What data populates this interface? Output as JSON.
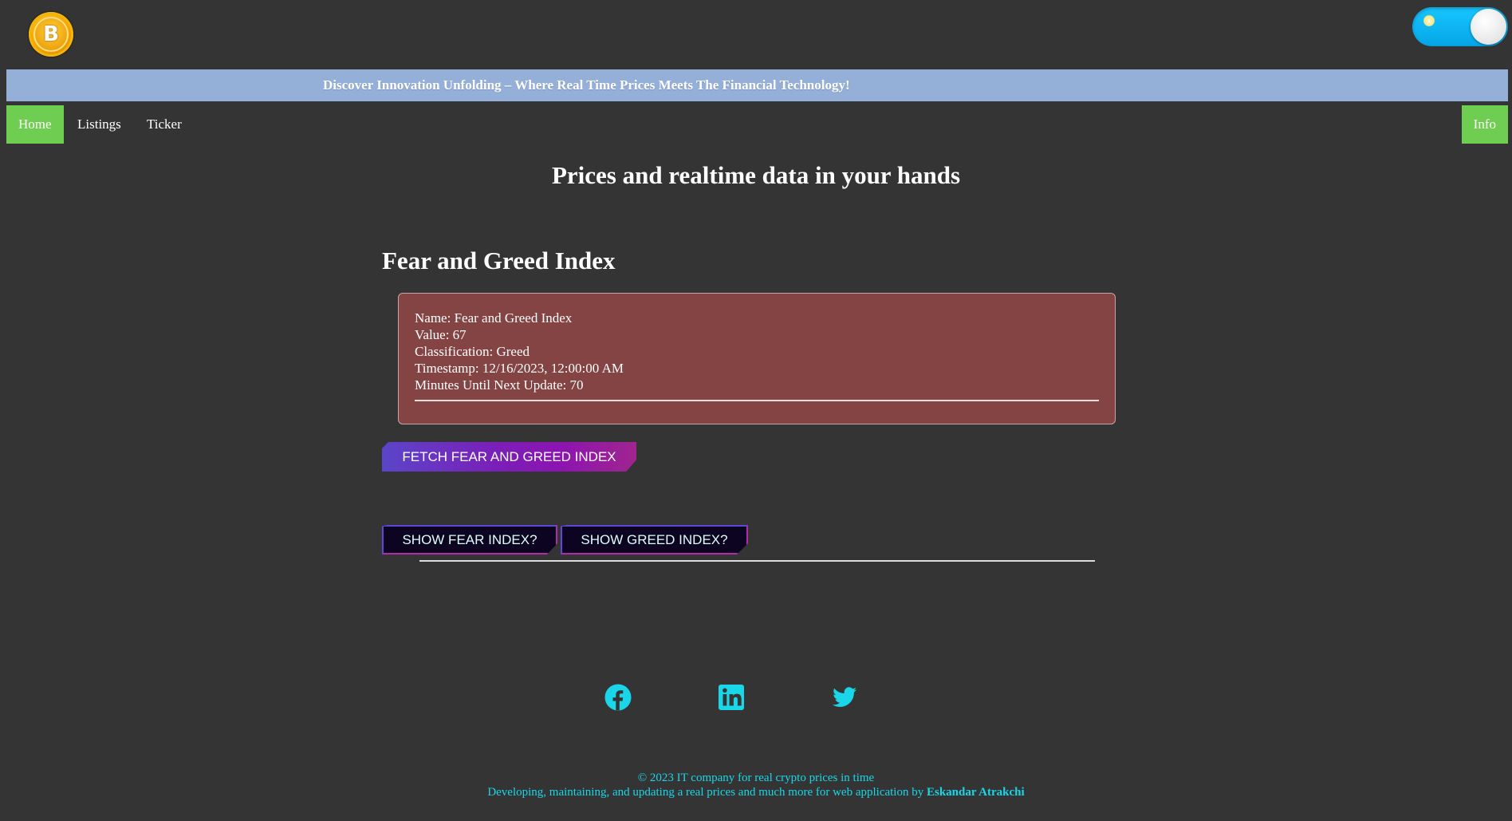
{
  "header": {
    "logo_icon": "bitcoin-logo-icon",
    "theme_toggle_icon": "theme-toggle-icon",
    "banner_text": "Discover Innovation Unfolding – Where Real Time Prices Meets The Financial Technology!",
    "logo_letter": "B"
  },
  "nav": {
    "home": "Home",
    "listings": "Listings",
    "ticker": "Ticker",
    "info": "Info"
  },
  "main": {
    "title": "Prices and realtime data in your hands",
    "section_title": "Fear and Greed Index",
    "card": {
      "name": "Name: Fear and Greed Index",
      "value": "Value: 67",
      "classification": "Classification: Greed",
      "timestamp": "Timestamp: 12/16/2023, 12:00:00 AM",
      "minutes": "Minutes Until Next Update: 70"
    },
    "fetch_button": "FETCH FEAR AND GREED INDEX",
    "show_fear_button": "SHOW FEAR INDEX?",
    "show_greed_button": "SHOW GREED INDEX?"
  },
  "footer": {
    "social_icons": [
      "facebook-icon",
      "linkedin-icon",
      "twitter-icon"
    ],
    "copyright": "© 2023 IT company for real crypto prices in time",
    "tagline_prefix": "Developing, maintaining, and updating a real prices and much more for web application by",
    "author": "Eskandar Atrakchi",
    "accent_color": "#19d7e8"
  },
  "colors": {
    "background": "#343434",
    "banner": "#95b0d8",
    "nav_active": "#6fce52",
    "card": "#844444"
  }
}
